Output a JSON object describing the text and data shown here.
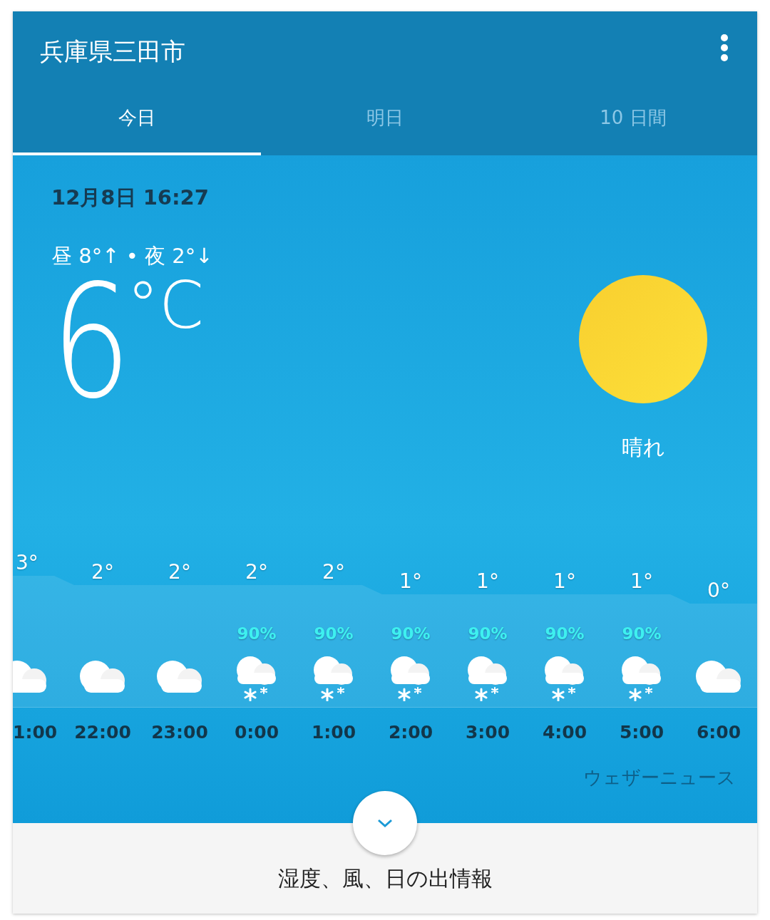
{
  "header": {
    "title": "兵庫県三田市"
  },
  "tabs": [
    {
      "label": "今日",
      "selected": true
    },
    {
      "label": "明日",
      "selected": false
    },
    {
      "label": "10 日間",
      "selected": false
    }
  ],
  "current": {
    "datetime": "12月8日 16:27",
    "high_low": "昼 8°↑ • 夜 2°↓",
    "temperature": "6",
    "unit": "°C",
    "condition": "晴れ"
  },
  "hourly": [
    {
      "temp": "3°",
      "kind": "cloud",
      "time": "1:00"
    },
    {
      "temp": "2°",
      "kind": "cloud",
      "time": "22:00"
    },
    {
      "temp": "2°",
      "kind": "cloud",
      "time": "23:00"
    },
    {
      "temp": "2°",
      "precip": "90%",
      "kind": "snow",
      "time": "0:00"
    },
    {
      "temp": "2°",
      "precip": "90%",
      "kind": "snow",
      "time": "1:00"
    },
    {
      "temp": "1°",
      "precip": "90%",
      "kind": "snow",
      "time": "2:00"
    },
    {
      "temp": "1°",
      "precip": "90%",
      "kind": "snow",
      "time": "3:00"
    },
    {
      "temp": "1°",
      "precip": "90%",
      "kind": "snow",
      "time": "4:00"
    },
    {
      "temp": "1°",
      "precip": "90%",
      "kind": "snow",
      "time": "5:00"
    },
    {
      "temp": "0°",
      "kind": "cloud",
      "time": "6:00"
    }
  ],
  "source": "ウェザーニュース",
  "footer": {
    "label": "湿度、風、日の出情報"
  }
}
